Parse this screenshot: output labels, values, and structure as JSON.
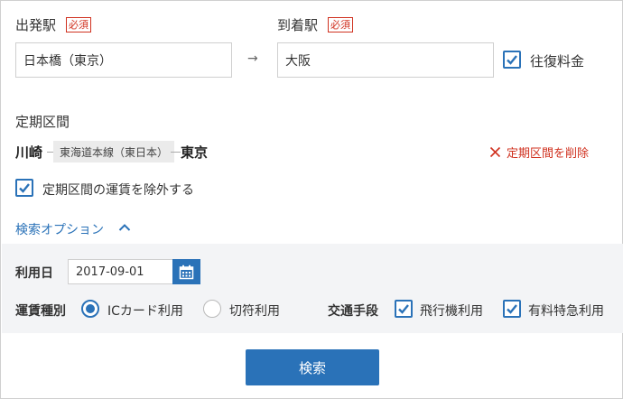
{
  "form": {
    "departure_label": "出発駅",
    "arrival_label": "到着駅",
    "required_badge": "必須",
    "departure_value": "日本橋（東京）",
    "arrival_value": "大阪",
    "arrow": "→",
    "round_trip_label": "往復料金",
    "round_trip_checked": true
  },
  "commuter": {
    "section_label": "定期区間",
    "from_station": "川崎",
    "line_name": "東海道本線（東日本）",
    "to_station": "東京",
    "delete_label": "定期区間を削除",
    "exclude_label": "定期区間の運賃を除外する",
    "exclude_checked": true
  },
  "options": {
    "toggle_label": "検索オプション",
    "expanded": true,
    "date_label": "利用日",
    "date_value": "2017-09-01",
    "fare_type_label": "運賃種別",
    "fare_types": [
      "ICカード利用",
      "切符利用"
    ],
    "fare_type_selected": "ICカード利用",
    "transport_label": "交通手段",
    "transport_options": [
      "飛行機利用",
      "有料特急利用"
    ],
    "transport_checked": [
      true,
      true
    ]
  },
  "search_button": "検索",
  "colors": {
    "accent": "#2a72b8",
    "required_red": "#d0311f",
    "panel_bg": "#f3f4f6"
  }
}
